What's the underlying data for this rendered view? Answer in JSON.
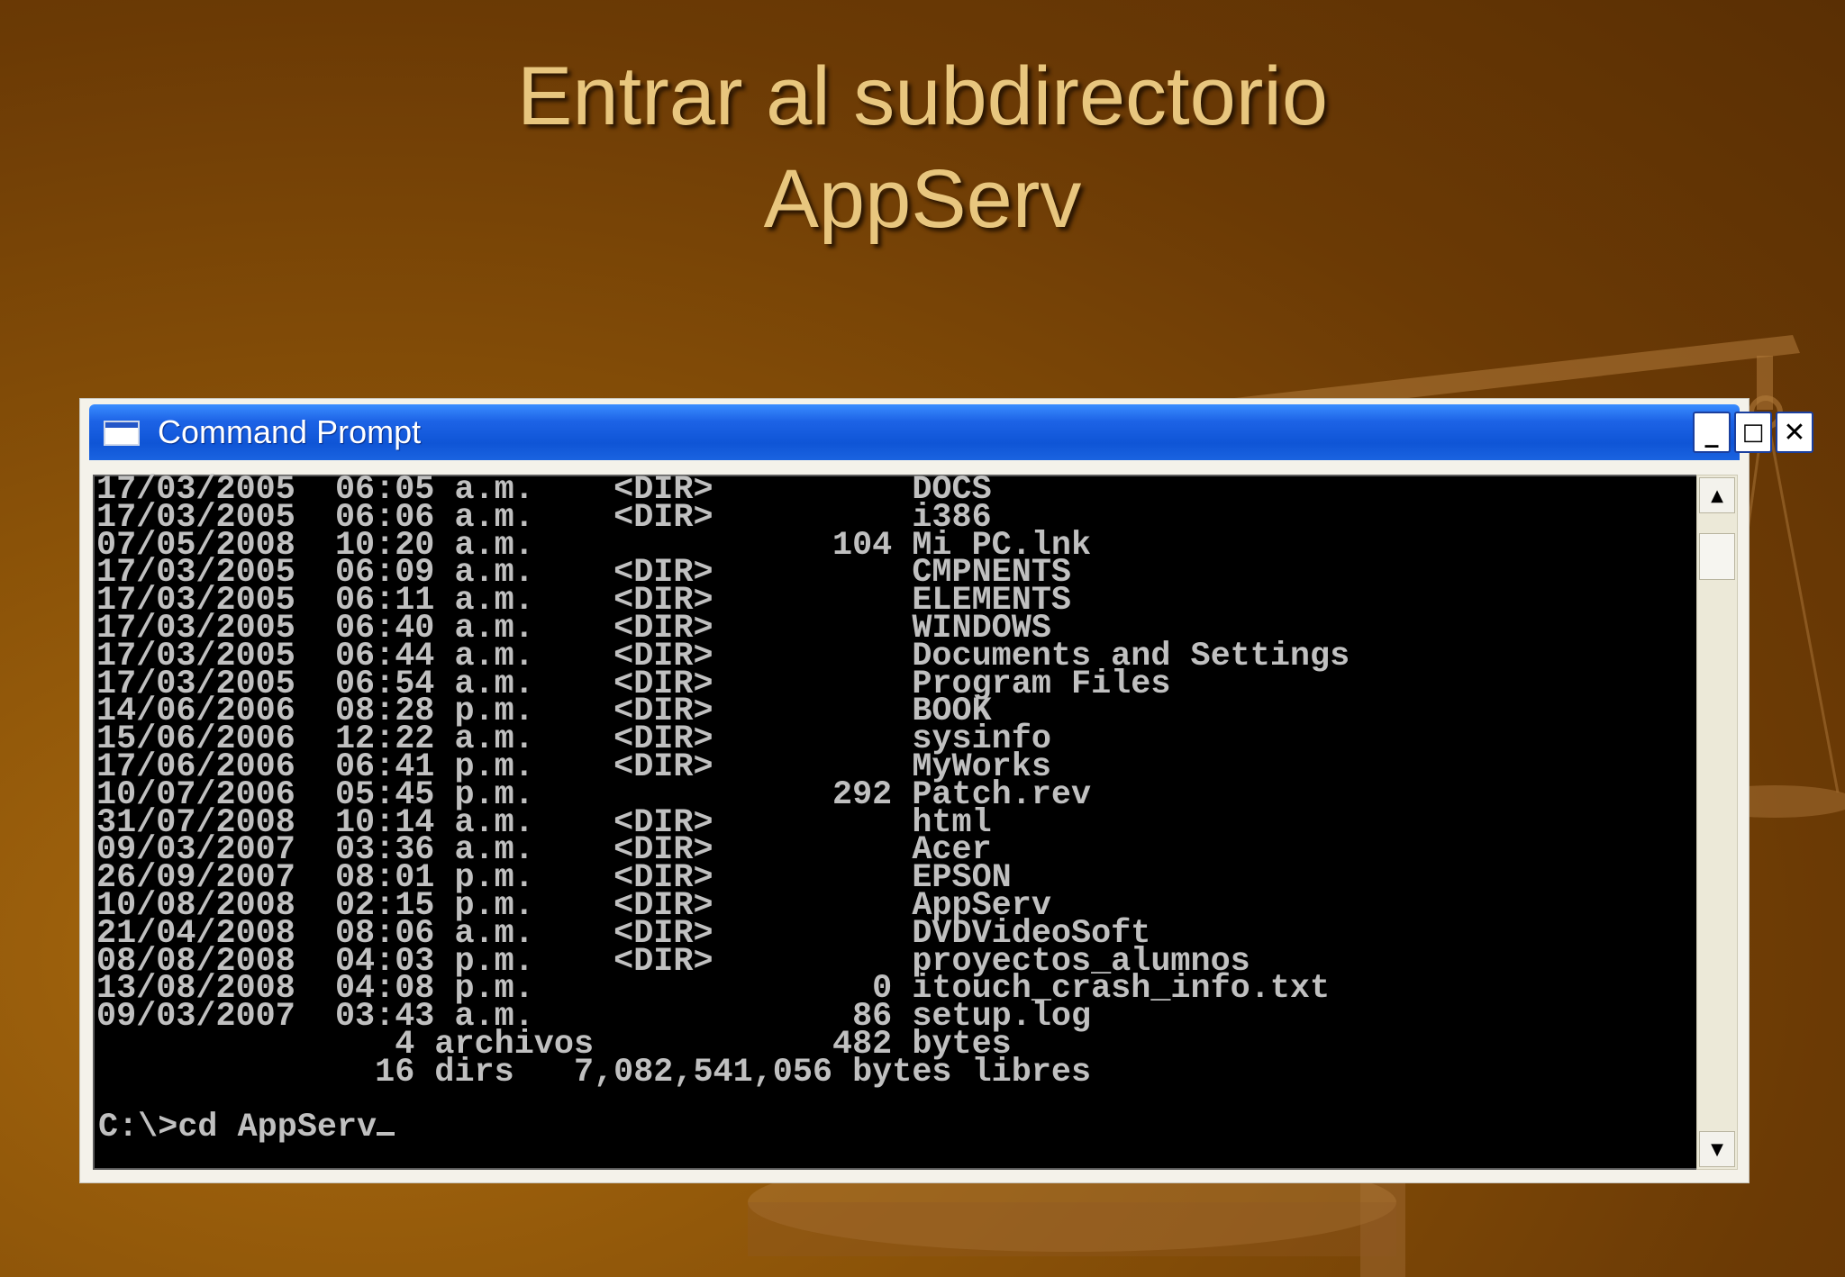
{
  "slide": {
    "title_line1": "Entrar al subdirectorio",
    "title_line2": "AppServ"
  },
  "window": {
    "title": "Command Prompt",
    "icon": "console-window-icon",
    "controls": {
      "minimize": "_",
      "maximize": "□",
      "close": "✕"
    }
  },
  "console": {
    "lines": [
      "17/03/2005  06:05 a.m.    <DIR>          DOCS",
      "17/03/2005  06:06 a.m.    <DIR>          i386",
      "07/05/2008  10:20 a.m.               104 Mi PC.lnk",
      "17/03/2005  06:09 a.m.    <DIR>          CMPNENTS",
      "17/03/2005  06:11 a.m.    <DIR>          ELEMENTS",
      "17/03/2005  06:40 a.m.    <DIR>          WINDOWS",
      "17/03/2005  06:44 a.m.    <DIR>          Documents and Settings",
      "17/03/2005  06:54 a.m.    <DIR>          Program Files",
      "14/06/2006  08:28 p.m.    <DIR>          BOOK",
      "15/06/2006  12:22 a.m.    <DIR>          sysinfo",
      "17/06/2006  06:41 p.m.    <DIR>          MyWorks",
      "10/07/2006  05:45 p.m.               292 Patch.rev",
      "31/07/2008  10:14 a.m.    <DIR>          html",
      "09/03/2007  03:36 a.m.    <DIR>          Acer",
      "26/09/2007  08:01 p.m.    <DIR>          EPSON",
      "10/08/2008  02:15 p.m.    <DIR>          AppServ",
      "21/04/2008  08:06 a.m.    <DIR>          DVDVideoSoft",
      "08/08/2008  04:03 p.m.    <DIR>          proyectos_alumnos",
      "13/08/2008  04:08 p.m.                 0 itouch_crash_info.txt",
      "09/03/2007  03:43 a.m.                86 setup.log",
      "               4 archivos            482 bytes",
      "              16 dirs   7,082,541,056 bytes libres"
    ],
    "prompt": "C:\\>cd AppServ"
  },
  "scrollbar": {
    "up_arrow": "▲",
    "down_arrow": "▼"
  },
  "colors": {
    "background": "#8a5208",
    "title_text": "#e8c67e",
    "titlebar": "#0f55d6",
    "console_bg": "#000000",
    "console_text": "#c0c0c0"
  }
}
